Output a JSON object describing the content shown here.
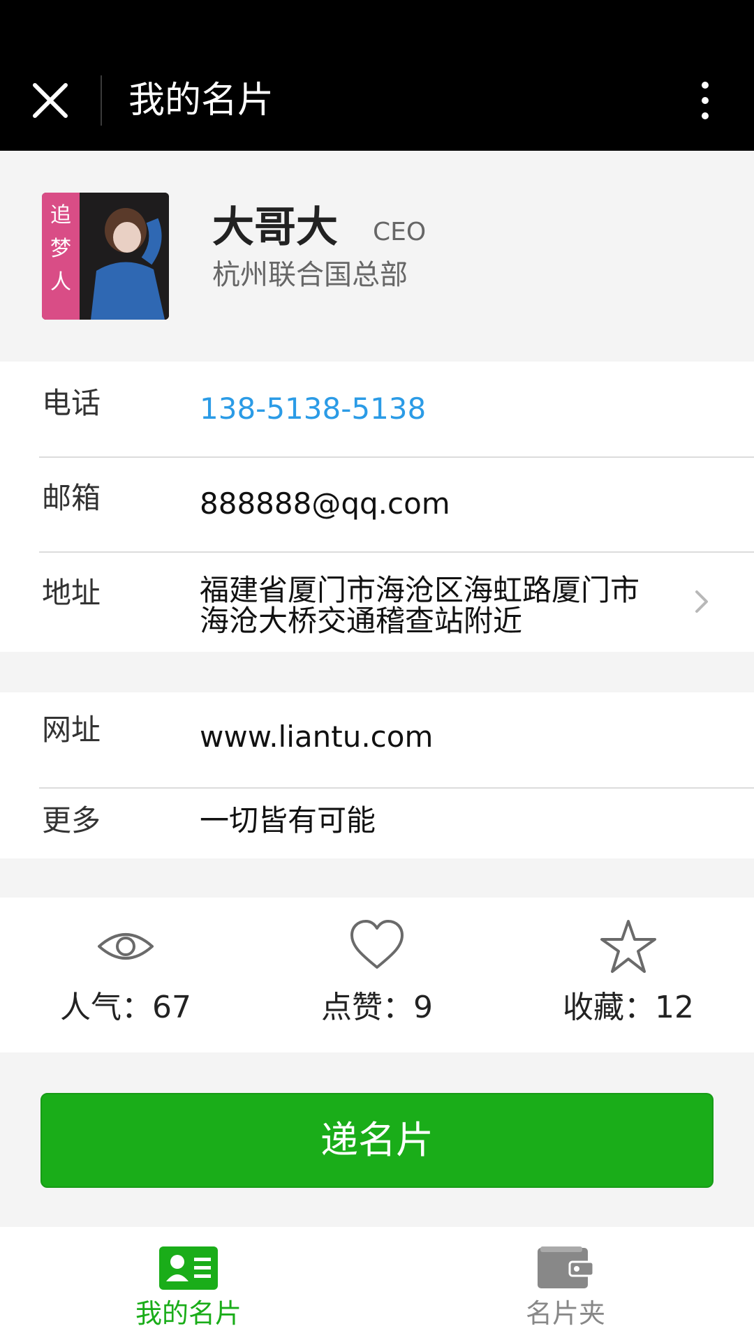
{
  "header": {
    "title": "我的名片"
  },
  "profile": {
    "name": "大哥大",
    "job_title": "CEO",
    "company": "杭州联合国总部",
    "avatar_caption": "追梦人"
  },
  "contact": {
    "phone_label": "电话",
    "phone_value": "138-5138-5138",
    "email_label": "邮箱",
    "email_value": "888888@qq.com",
    "address_label": "地址",
    "address_line1": "福建省厦门市海沧区海虹路厦门市",
    "address_line2": "海沧大桥交通稽查站附近",
    "website_label": "网址",
    "website_value": "www.liantu.com",
    "more_label": "更多",
    "more_value": "一切皆有可能"
  },
  "stats": [
    {
      "icon": "eye-icon",
      "label": "人气：67"
    },
    {
      "icon": "heart-icon",
      "label": "点赞：9"
    },
    {
      "icon": "star-icon",
      "label": "收藏：12"
    }
  ],
  "actions": {
    "share_label": "递名片"
  },
  "tabs": [
    {
      "icon": "card-icon",
      "label": "我的名片",
      "active": true
    },
    {
      "icon": "wallet-icon",
      "label": "名片夹",
      "active": false
    }
  ],
  "colors": {
    "accent_green": "#1aad19",
    "link_blue": "#2b9be6",
    "header_bg": "#000000"
  }
}
